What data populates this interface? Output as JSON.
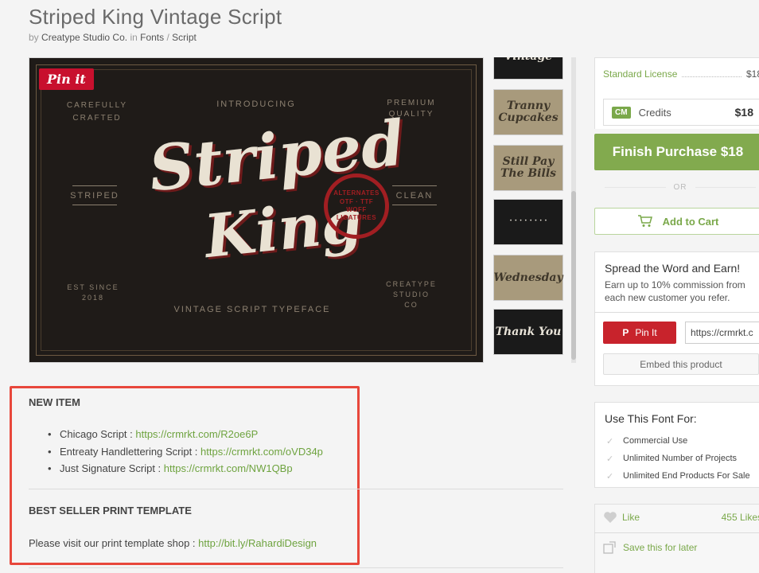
{
  "product": {
    "title": "Striped King Vintage Script",
    "by_label": "by",
    "author": "Creatype Studio Co.",
    "in_label": "in",
    "category": "Fonts",
    "separator": "/",
    "subcategory": "Script"
  },
  "preview": {
    "pin_label": "Pin it",
    "top_left": "CAREFULLY\nCRAFTED",
    "introducing": "INTRODUCING",
    "top_right": "PREMIUM\nQUALITY",
    "left_side": "STRIPED",
    "right_side": "CLEAN",
    "script_line1": "Striped",
    "script_line2": "King",
    "stamp": "ALTERNATES\nOTF · TTF\nWOFF\nLIGATURES",
    "bottom_left": "EST SINCE\n2018",
    "tagline": "VINTAGE SCRIPT TYPEFACE",
    "bottom_right": "CREATYPE\nSTUDIO\nCO"
  },
  "thumbnails": [
    {
      "text": "Vintage",
      "style": "dark"
    },
    {
      "text": "Tranny Cupcakes",
      "style": "tan"
    },
    {
      "text": "Still Pay The Bills",
      "style": "tan"
    },
    {
      "text": "· · · · · · · ·",
      "style": "dark"
    },
    {
      "text": "Wednesday",
      "style": "tan"
    },
    {
      "text": "Thank You",
      "style": "dark"
    }
  ],
  "description": {
    "heading_new": "NEW ITEM",
    "items": [
      {
        "label": "Chicago Script : ",
        "url": "https://crmrkt.com/R2oe6P"
      },
      {
        "label": "Entreaty Handlettering Script : ",
        "url": "https://crmrkt.com/oVD34p"
      },
      {
        "label": "Just Signature Script : ",
        "url": "https://crmrkt.com/NW1QBp"
      }
    ],
    "heading_best": "BEST SELLER PRINT TEMPLATE",
    "visit_text": "Please visit our print template shop : ",
    "visit_url": "http://bit.ly/RahardiDesign"
  },
  "sidebar": {
    "license_label": "Standard License",
    "license_price": "$18",
    "credits_icon": "CM",
    "credits_label": "Credits",
    "credits_price": "$18",
    "finish_label": "Finish Purchase $18",
    "or_label": "OR",
    "add_to_cart": "Add to Cart",
    "spread_title": "Spread the Word and Earn!",
    "spread_sub": "Earn up to 10% commission from each new customer you refer.",
    "pin_it": "Pin It",
    "share_url": "https://crmrkt.c",
    "embed": "Embed this product",
    "use_title": "Use This Font For:",
    "uses": [
      "Commercial Use",
      "Unlimited Number of Projects",
      "Unlimited End Products For Sale"
    ],
    "like_label": "Like",
    "like_count": "455 Likes",
    "save_label": "Save this for later"
  },
  "colors": {
    "accent_green": "#82aa4e",
    "pinterest_red": "#c8232c",
    "highlight_red": "#e8473b"
  }
}
